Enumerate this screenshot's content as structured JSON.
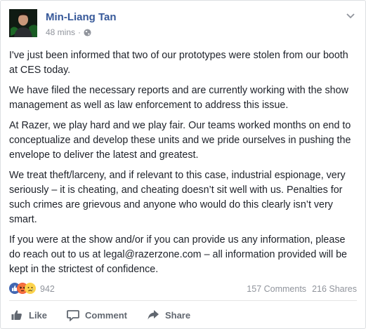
{
  "post": {
    "author": "Min-Liang Tan",
    "time": "48 mins",
    "separator": "·",
    "paragraphs": [
      "I've just been informed that two of our prototypes were stolen from our booth at CES today.",
      "We have filed the necessary reports and are currently working with the show management as well as law enforcement to address this issue.",
      "At Razer, we play hard and we play fair. Our teams worked months on end to conceptualize and develop these units and we pride ourselves in pushing the envelope to deliver the latest and greatest.",
      "We treat theft/larceny, and if relevant to this case, industrial espionage, very seriously – it is cheating, and cheating doesn’t sit well with us. Penalties for such crimes are grievous and anyone who would do this clearly isn’t very smart.",
      "If you were at the show and/or if you can provide us any information, please do reach out to us at legal@razerzone.com – all information provided will be kept in the strictest of confidence."
    ]
  },
  "reactions": {
    "icons": [
      "like-reaction-icon",
      "angry-reaction-icon",
      "sad-reaction-icon"
    ],
    "count": "942",
    "comments": "157 Comments",
    "shares": "216 Shares"
  },
  "actions": {
    "like": "Like",
    "comment": "Comment",
    "share": "Share"
  },
  "colors": {
    "author_link": "#365899",
    "like_blue": "#4267b2",
    "angry": "#f0543c",
    "sad": "#fcd34d",
    "meta_gray": "#90949c",
    "action_gray": "#616770"
  }
}
